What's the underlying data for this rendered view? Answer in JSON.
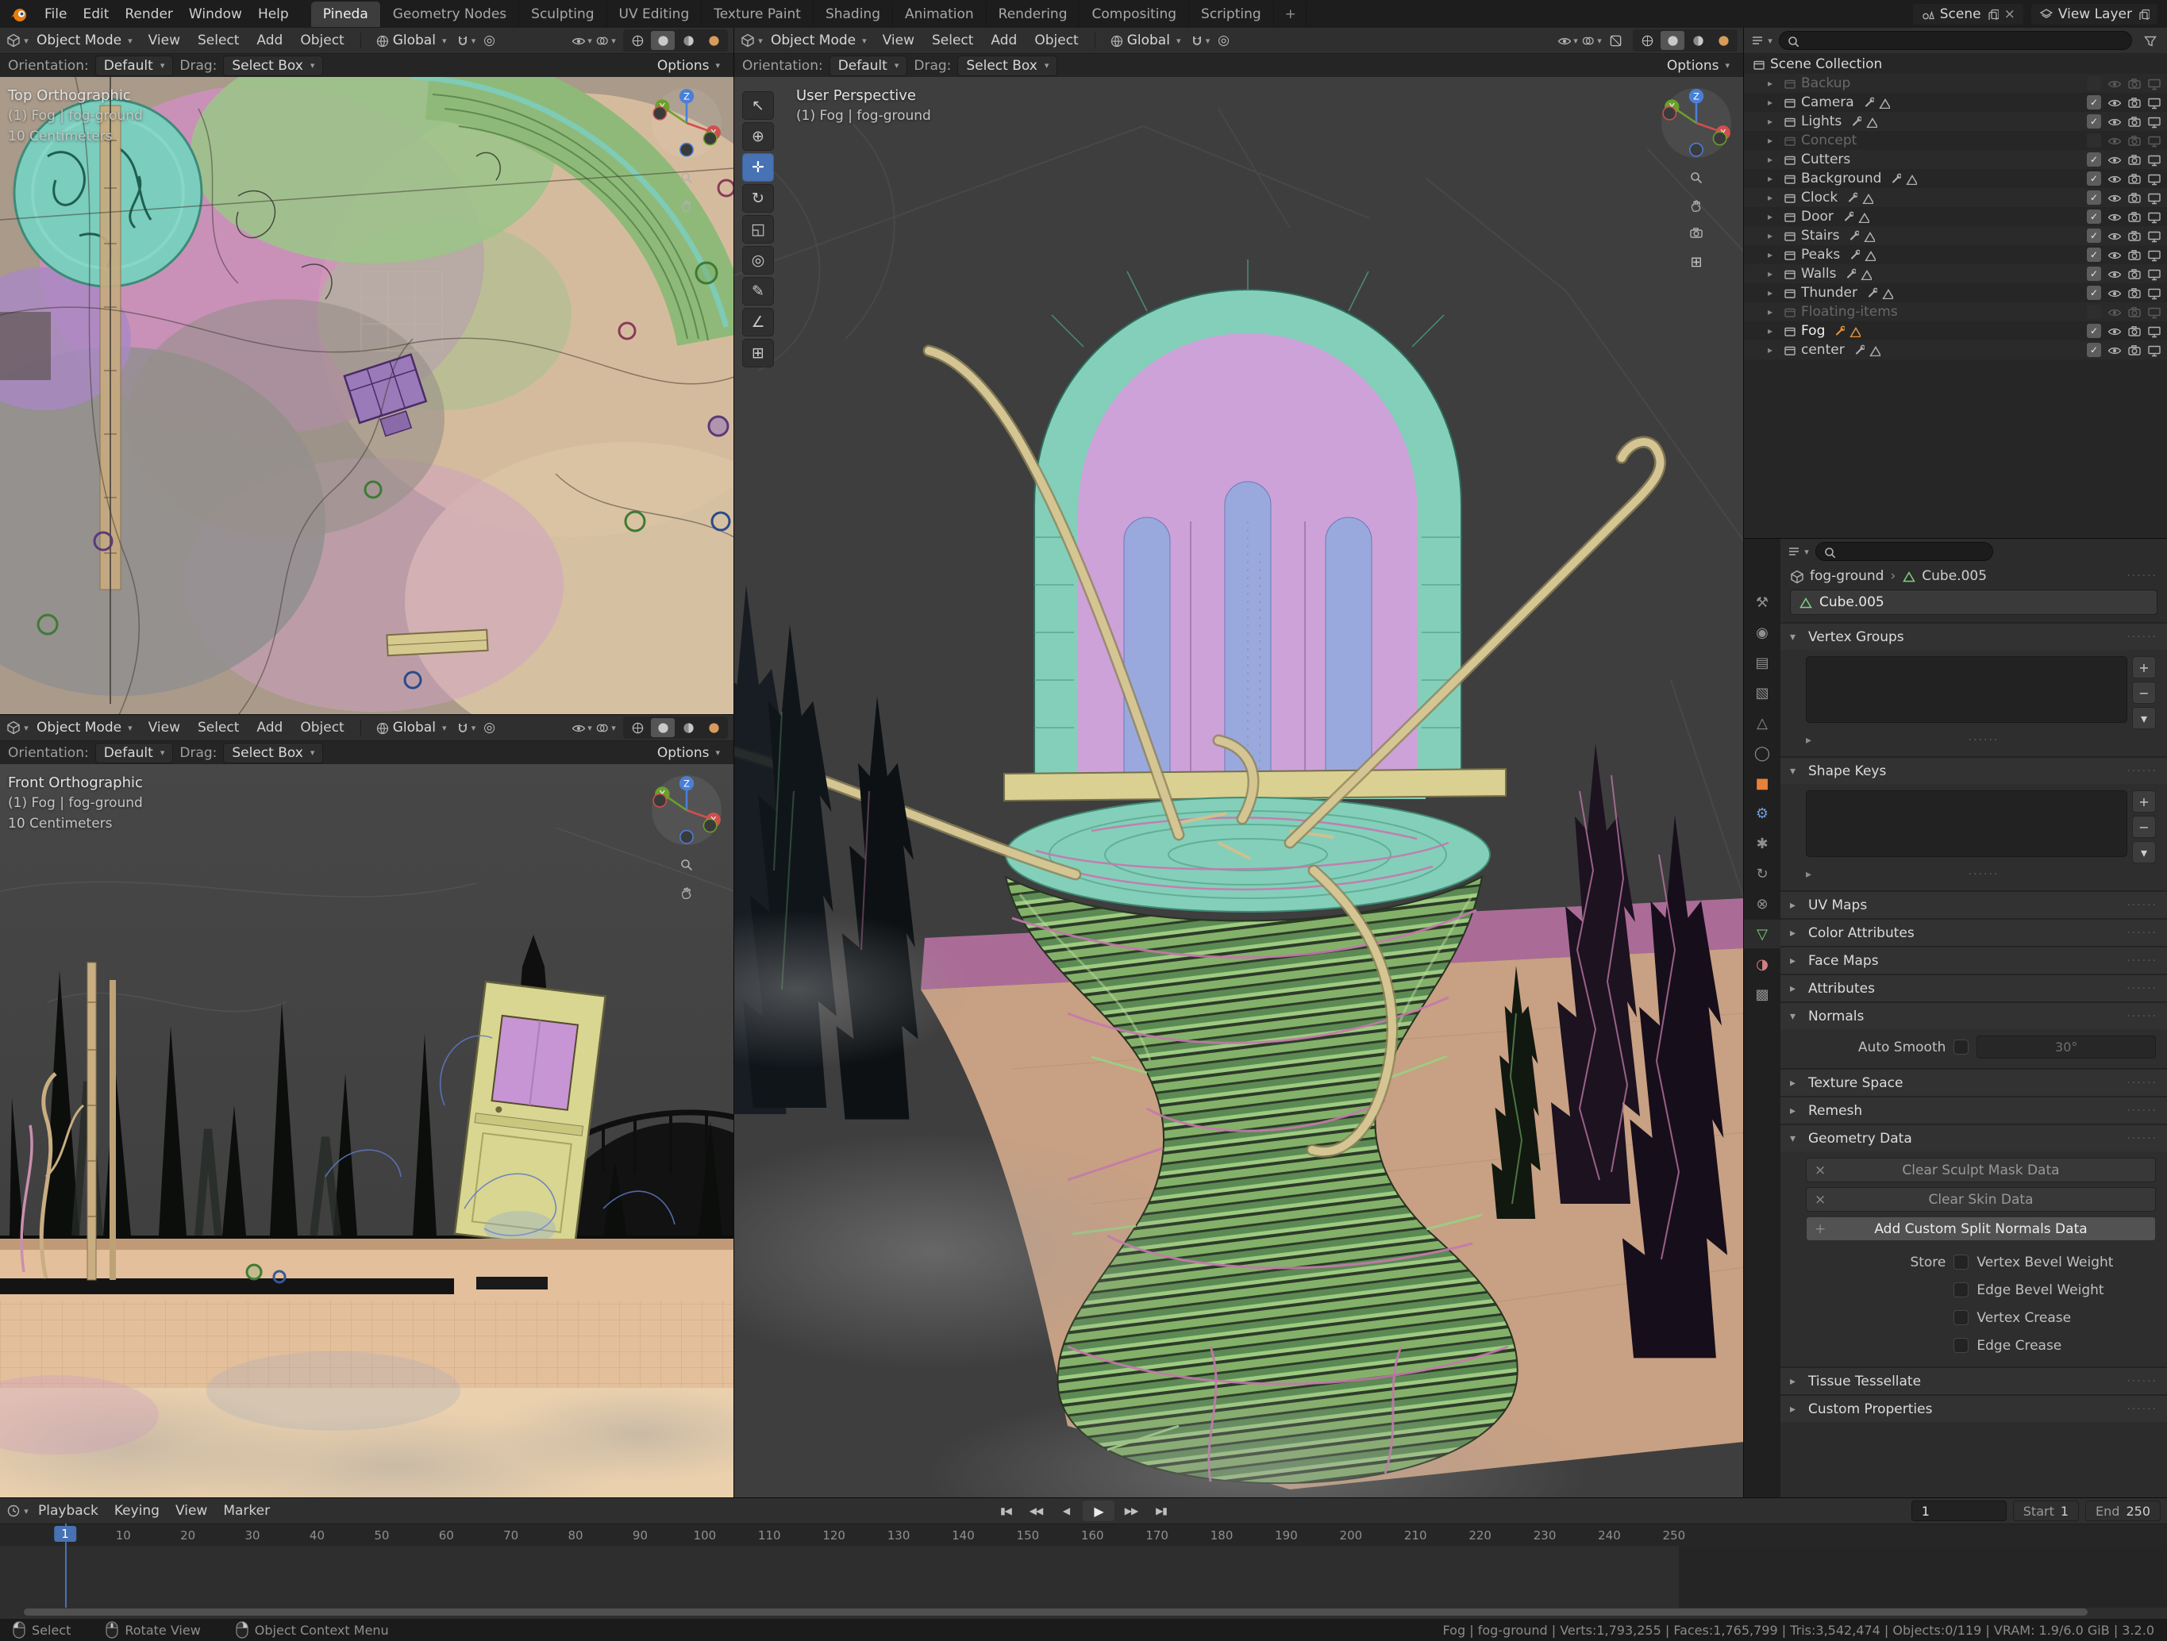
{
  "topbar": {
    "menus": [
      "File",
      "Edit",
      "Render",
      "Window",
      "Help"
    ],
    "workspaces": [
      {
        "label": "Pineda",
        "active": true
      },
      {
        "label": "Geometry Nodes"
      },
      {
        "label": "Sculpting"
      },
      {
        "label": "UV Editing"
      },
      {
        "label": "Texture Paint"
      },
      {
        "label": "Shading"
      },
      {
        "label": "Animation"
      },
      {
        "label": "Rendering"
      },
      {
        "label": "Compositing"
      },
      {
        "label": "Scripting"
      }
    ],
    "add_workspace_label": "+",
    "scene_label": "Scene",
    "view_layer_label": "View Layer"
  },
  "viewport_header": {
    "mode": "Object Mode",
    "menu_view": "View",
    "menu_select": "Select",
    "menu_add": "Add",
    "menu_object": "Object",
    "orientation": "Global",
    "options_label": "Options"
  },
  "tool_settings": {
    "orientation_label": "Orientation:",
    "orientation_value": "Default",
    "drag_label": "Drag:",
    "drag_value": "Select Box"
  },
  "viewports": {
    "top": {
      "view_label": "Top Orthographic",
      "context_label": "(1) Fog | fog-ground",
      "scale_label": "10 Centimeters"
    },
    "front": {
      "view_label": "Front Orthographic",
      "context_label": "(1) Fog | fog-ground",
      "scale_label": "10 Centimeters"
    },
    "main": {
      "view_label": "User Perspective",
      "context_label": "(1) Fog | fog-ground"
    }
  },
  "toolbar": [
    {
      "glyph": "↖"
    },
    {
      "glyph": "⊕"
    },
    {
      "glyph": "✛",
      "active": true
    },
    {
      "glyph": "↻"
    },
    {
      "glyph": "◱"
    },
    {
      "glyph": "◎"
    },
    {
      "glyph": "✎"
    },
    {
      "glyph": "∠"
    },
    {
      "glyph": "⊞"
    }
  ],
  "outliner": {
    "root_label": "Scene Collection",
    "items": [
      {
        "name": "Backup",
        "muted": true
      },
      {
        "name": "Camera",
        "has_tools": true
      },
      {
        "name": "Lights",
        "has_tools": true
      },
      {
        "name": "Concept",
        "muted": true
      },
      {
        "name": "Cutters"
      },
      {
        "name": "Background",
        "has_tools": true
      },
      {
        "name": "Clock",
        "has_tools": true
      },
      {
        "name": "Door",
        "has_tools": true
      },
      {
        "name": "Stairs",
        "has_tools": true
      },
      {
        "name": "Peaks",
        "has_tools": true
      },
      {
        "name": "Walls",
        "has_tools": true
      },
      {
        "name": "Thunder",
        "has_tools": true
      },
      {
        "name": "Floating-items",
        "muted": true
      },
      {
        "name": "Fog",
        "selected": true,
        "has_tools": true
      },
      {
        "name": "center",
        "has_tools": true
      }
    ]
  },
  "properties_tabs": [
    {
      "glyph": "⚒"
    },
    {
      "glyph": "◉"
    },
    {
      "glyph": "▤"
    },
    {
      "glyph": "▧"
    },
    {
      "glyph": "△"
    },
    {
      "glyph": "◯"
    },
    {
      "glyph": "■",
      "orange": true
    },
    {
      "glyph": "⚙",
      "blue": true
    },
    {
      "glyph": "✱"
    },
    {
      "glyph": "↻"
    },
    {
      "glyph": "⊗"
    },
    {
      "glyph": "▽",
      "green": true,
      "active": true
    },
    {
      "glyph": "◑",
      "red": true
    },
    {
      "glyph": "▩"
    }
  ],
  "properties": {
    "breadcrumb_object": "fog-ground",
    "breadcrumb_data": "Cube.005",
    "name_field": "Cube.005",
    "panels": {
      "vertex_groups": "Vertex Groups",
      "shape_keys": "Shape Keys",
      "uv_maps": "UV Maps",
      "color_attributes": "Color Attributes",
      "face_maps": "Face Maps",
      "attributes": "Attributes",
      "normals": "Normals",
      "texture_space": "Texture Space",
      "remesh": "Remesh",
      "geometry_data": "Geometry Data",
      "tissue_tessellate": "Tissue Tessellate",
      "custom_properties": "Custom Properties"
    },
    "normals": {
      "auto_smooth_label": "Auto Smooth",
      "angle_value": "30°"
    },
    "geometry_data": {
      "clear_sculpt_label": "Clear Sculpt Mask Data",
      "clear_skin_label": "Clear Skin Data",
      "add_split_normals_label": "Add Custom Split Normals Data",
      "store_label": "Store",
      "checkboxes": [
        "Vertex Bevel Weight",
        "Edge Bevel Weight",
        "Vertex Crease",
        "Edge Crease"
      ]
    }
  },
  "timeline": {
    "menus": [
      "Playback",
      "Keying",
      "View",
      "Marker"
    ],
    "transport": [
      {
        "glyph": "▮◀"
      },
      {
        "glyph": "◀◀"
      },
      {
        "glyph": "◀"
      },
      {
        "glyph": "▶",
        "play": true
      },
      {
        "glyph": "▶▶"
      },
      {
        "glyph": "▶▮"
      }
    ],
    "current_frame": "1",
    "start_label": "Start",
    "start_value": "1",
    "end_label": "End",
    "end_value": "250",
    "ticks": [
      10,
      20,
      30,
      40,
      50,
      60,
      70,
      80,
      90,
      100,
      110,
      120,
      130,
      140,
      150,
      160,
      170,
      180,
      190,
      200,
      210,
      220,
      230,
      240,
      250
    ]
  },
  "statusbar": {
    "keymap": [
      {
        "label": "Select",
        "lmb": true
      },
      {
        "label": "Rotate View",
        "mmb": true
      },
      {
        "label": "Object Context Menu",
        "rmb": true
      }
    ],
    "stats": "Fog | fog-ground | Verts:1,793,255 | Faces:1,765,799 | Tris:3,542,474 | Objects:0/119 | VRAM: 1.9/6.0 GiB | 3.2.0"
  },
  "icons": {
    "chevron": "▾",
    "panel_open": "▾",
    "panel_closed": "▸",
    "row_closed": "▸",
    "check": "✓",
    "close": "×",
    "add": "+",
    "remove": "−",
    "proportional": "◎",
    "grid": "⊞",
    "specials": "▸",
    "grip_dots": "······"
  },
  "colors": {
    "accent_blue": "#4772b3",
    "object_orange": "#e8953a",
    "mesh_green": "#7fd07f"
  }
}
